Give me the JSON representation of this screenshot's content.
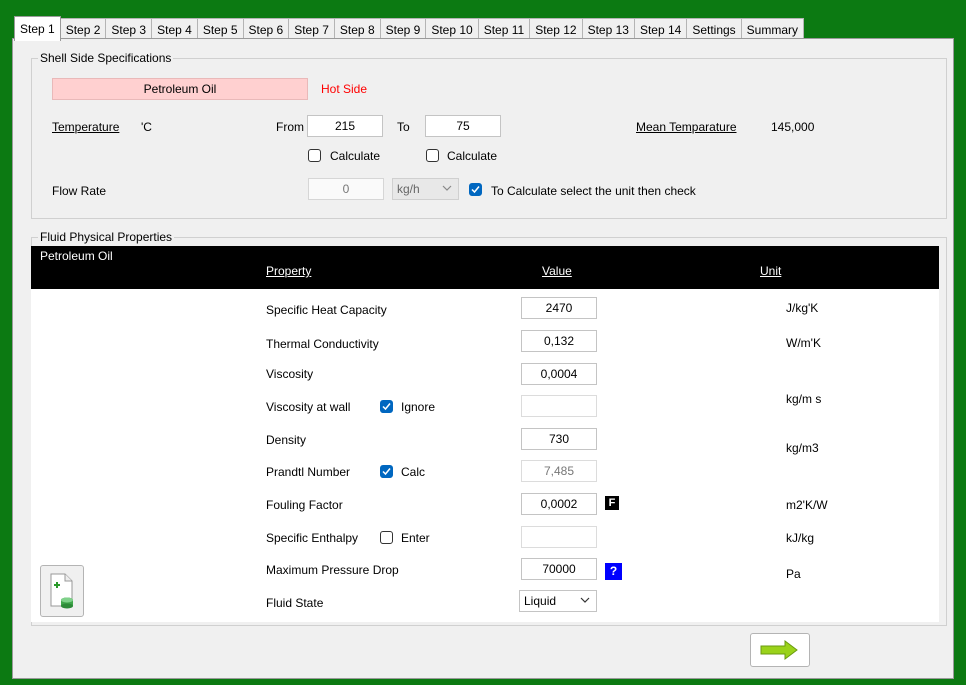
{
  "tabs": [
    "Step 1",
    "Step 2",
    "Step 3",
    "Step 4",
    "Step 5",
    "Step 6",
    "Step 7",
    "Step 8",
    "Step 9",
    "Step 10",
    "Step 11",
    "Step 12",
    "Step 13",
    "Step 14",
    "Settings",
    "Summary"
  ],
  "shell": {
    "legend": "Shell Side Specifications",
    "fluid_name": "Petroleum Oil",
    "side": "Hot Side",
    "temperature_label": "Temperature",
    "temperature_unit": "'C",
    "from_label": "From",
    "from_value": "215",
    "to_label": "To",
    "to_value": "75",
    "calculate_label_1": "Calculate",
    "calculate_label_2": "Calculate",
    "mean_label": "Mean Temparature",
    "mean_value": "145,000",
    "flow_rate_label": "Flow Rate",
    "flow_rate_value": "0",
    "flow_unit": "kg/h",
    "flow_hint": "To Calculate select the unit then check"
  },
  "props": {
    "legend": "Fluid Physical Properties",
    "fluid_name": "Petroleum Oil",
    "header_property": "Property",
    "header_value": "Value",
    "header_unit": "Unit",
    "rows": {
      "cp": {
        "label": "Specific Heat Capacity",
        "value": "2470",
        "unit": "J/kg'K"
      },
      "k": {
        "label": "Thermal Conductivity",
        "value": "0,132",
        "unit": "W/m'K"
      },
      "mu": {
        "label": "Viscosity",
        "value": "0,0004"
      },
      "muw": {
        "label": "Viscosity at wall",
        "check": "Ignore",
        "value": "",
        "unit": "kg/m s"
      },
      "rho": {
        "label": "Density",
        "value": "730",
        "unit": "kg/m3"
      },
      "pr": {
        "label": "Prandtl Number",
        "check": "Calc",
        "value": "7,485"
      },
      "ff": {
        "label": "Fouling Factor",
        "value": "0,0002",
        "badge": "F",
        "unit": "m2'K/W"
      },
      "h": {
        "label": "Specific Enthalpy",
        "check": "Enter",
        "value": "",
        "unit": "kJ/kg"
      },
      "dp": {
        "label": "Maximum Pressure Drop",
        "value": "70000",
        "badge": "?",
        "unit": "Pa"
      },
      "state": {
        "label": "Fluid State",
        "value": "Liquid"
      }
    }
  },
  "colors": {
    "background": "#0c7a12",
    "fluid_button": "#ffd0d0",
    "hot_side": "#ff0000",
    "checkbox": "#0067c0",
    "help_badge": "#0000ff"
  }
}
